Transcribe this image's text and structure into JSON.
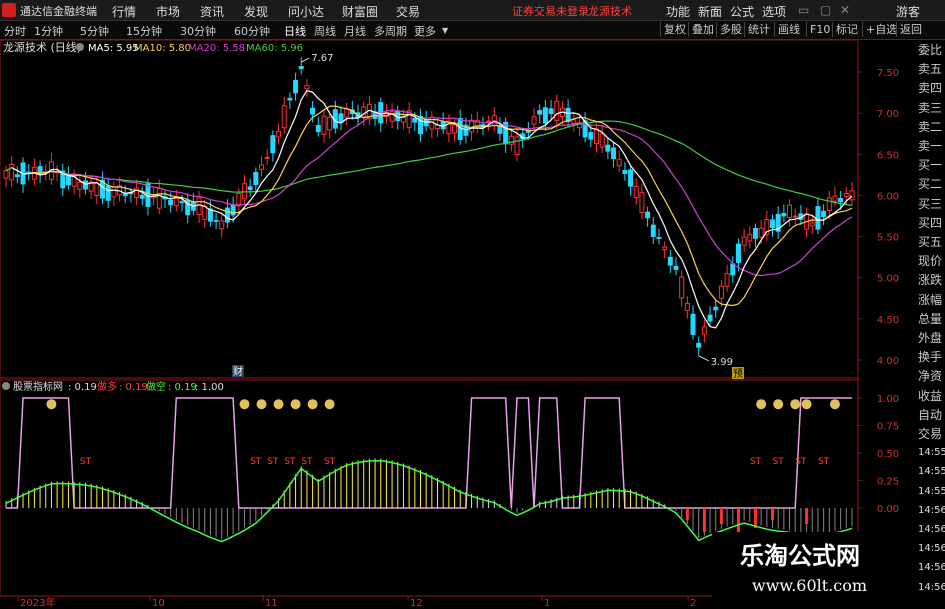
{
  "menubar": {
    "app_title": "通达信金融终端",
    "items": [
      "行情",
      "市场",
      "资讯",
      "发现",
      "问小达",
      "财富圈",
      "交易"
    ],
    "login_notice": "证券交易未登录",
    "stock_name": "龙源技术",
    "right_items": [
      "功能",
      "新面",
      "公式",
      "选项"
    ],
    "guest": "游客"
  },
  "toolbar": {
    "periods": [
      "分时",
      "1分钟",
      "5分钟",
      "15分钟",
      "30分钟",
      "60分钟",
      "日线",
      "周线",
      "月线",
      "多周期",
      "更多"
    ],
    "selected": "日线",
    "right_buttons": [
      "复权",
      "叠加",
      "多股",
      "统计",
      "画线",
      "F10",
      "标记",
      "+自选",
      "返回"
    ]
  },
  "main_chart": {
    "title": "龙源技术 (日线)",
    "legend": [
      {
        "label": "MA5: 5.95",
        "color": "#ffffff"
      },
      {
        "label": "MA10: 5.80",
        "color": "#ffd24a"
      },
      {
        "label": "MA20: 5.58",
        "color": "#d040d0"
      },
      {
        "label": "MA60: 5.96",
        "color": "#40d040"
      }
    ],
    "high_label": "7.67",
    "low_label": "3.99",
    "marker_cai": "财",
    "marker_yu": "预",
    "y_ticks": [
      "7.50",
      "7.00",
      "6.50",
      "6.00",
      "5.50",
      "5.00",
      "4.50",
      "4.00"
    ],
    "colors": {
      "up": "#ff3030",
      "down": "#22d8ff",
      "ma5": "#ffffff",
      "ma10": "#ffd24a",
      "ma20": "#d040d0",
      "ma60": "#40d040",
      "grid": "#8b1a1a"
    }
  },
  "sub_chart": {
    "title": "股票指标网",
    "value1": ": 0.19",
    "label_duo": "做多",
    "value_duo": ": 0.19",
    "label_kong": "做空",
    "value_kong": ": 0.19",
    "value_last": ": 1.00",
    "y_ticks": [
      "1.00",
      "0.75",
      "0.50",
      "0.25",
      "0.00"
    ],
    "signal_text": "ST",
    "colors": {
      "duo": "#ff4040",
      "kong": "#40ff40",
      "step": "#e8a0e8"
    }
  },
  "x_axis": {
    "labels": [
      "2023年",
      "10",
      "11",
      "12",
      "1",
      "2"
    ]
  },
  "sidebar": {
    "labels": [
      "委比",
      "卖五",
      "卖四",
      "卖三",
      "卖二",
      "卖一",
      "买一",
      "买二",
      "买三",
      "买四",
      "买五",
      "现价",
      "涨跌",
      "涨幅",
      "总量",
      "外盘",
      "换手",
      "净资",
      "收益",
      "自动",
      "交易",
      "14:55",
      "14:55",
      "14:55",
      "14:56",
      "14:56",
      "14:56",
      "14:56",
      "14:56"
    ]
  },
  "watermark": {
    "cn": "乐淘公式网",
    "url": "www.60lt.com"
  }
}
